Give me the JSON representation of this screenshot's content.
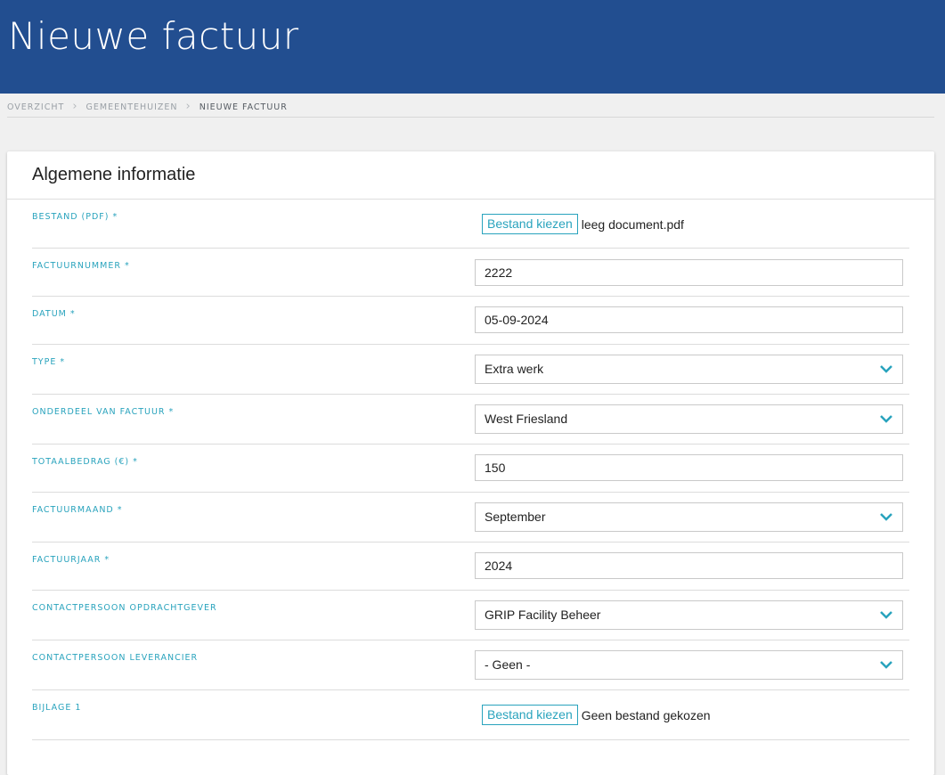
{
  "header": {
    "title": "Nieuwe factuur",
    "bg_color": "#224e90"
  },
  "breadcrumb": {
    "items": [
      "OVERZICHT",
      "GEMEENTEHUIZEN",
      "NIEUWE FACTUUR"
    ],
    "separator_icon": "chevron-right-icon"
  },
  "form": {
    "section_title": "Algemene informatie",
    "accent_color": "#29a3bd",
    "fields": {
      "bestand": {
        "label": "BESTAND (PDF) *",
        "button": "Bestand kiezen",
        "file": "leeg document.pdf"
      },
      "factuurnummer": {
        "label": "FACTUURNUMMER *",
        "value": "2222"
      },
      "datum": {
        "label": "DATUM *",
        "value": "05-09-2024"
      },
      "type": {
        "label": "TYPE *",
        "value": "Extra werk"
      },
      "onderdeel": {
        "label": "ONDERDEEL VAN FACTUUR *",
        "value": "West Friesland"
      },
      "totaalbedrag": {
        "label": "TOTAALBEDRAG (€) *",
        "value": "150"
      },
      "factuurmaand": {
        "label": "FACTUURMAAND *",
        "value": "September"
      },
      "factuurjaar": {
        "label": "FACTUURJAAR *",
        "value": "2024"
      },
      "contact_opdrachtgever": {
        "label": "CONTACTPERSOON OPDRACHTGEVER",
        "value": "GRIP Facility Beheer"
      },
      "contact_leverancier": {
        "label": "CONTACTPERSOON LEVERANCIER",
        "value": "- Geen -"
      },
      "bijlage1": {
        "label": "BIJLAGE 1",
        "button": "Bestand kiezen",
        "file": "Geen bestand gekozen"
      }
    }
  }
}
